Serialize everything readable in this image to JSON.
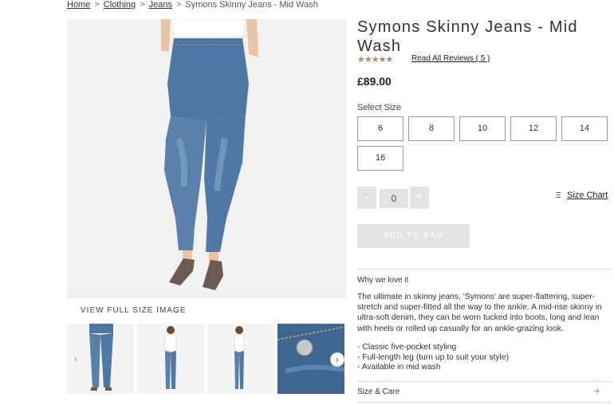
{
  "breadcrumb": {
    "items": [
      "Home",
      "Clothing",
      "Jeans"
    ],
    "separator": ">",
    "current": "Symons Skinny Jeans - Mid Wash"
  },
  "gallery": {
    "view_full_label": "VIEW FULL SIZE IMAGE",
    "prev_icon": "chevron-left-icon",
    "next_icon": "chevron-right-icon",
    "prev_glyph": "‹",
    "next_glyph": "›"
  },
  "product": {
    "title": "Symons Skinny Jeans - Mid Wash",
    "rating": 4.5,
    "rating_stars": "★★★★★",
    "reviews_label": "Read All Reviews ( 5 )",
    "price": "£89.00"
  },
  "sizes": {
    "label": "Select Size",
    "options": [
      "6",
      "8",
      "10",
      "12",
      "14",
      "16"
    ]
  },
  "quantity": {
    "minus": "-",
    "value": "0",
    "plus": "+"
  },
  "size_chart": {
    "icon": "ruler-icon",
    "icon_glyph": "Ξ",
    "label": "Size Chart"
  },
  "add_to_bag_label": "ADD TO BAG",
  "details": {
    "heading": "Why we love it",
    "description": "The ultimate in skinny jeans, 'Symons' are super-flattering, super-stretch and super-fitted all the way to the ankle. A mid-rise skinny in ultra-soft denim, they can be worn tucked into boots, long and lean with heels or rolled up casually for an ankle-grazing look.",
    "bullets": [
      "- Classic five-pocket styling",
      "- Full-length leg (turn up to suit your style)",
      "- Available in mid wash"
    ]
  },
  "size_care": {
    "label": "Size & Care",
    "toggle": "+"
  },
  "colors": {
    "denim": "#5b7fa8",
    "star": "#b08a5a",
    "disabled_button": "#e3e3e3"
  }
}
